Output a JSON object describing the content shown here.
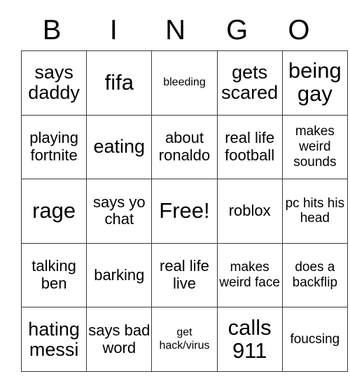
{
  "card": {
    "title": "BINGO",
    "headers": [
      "B",
      "I",
      "N",
      "G",
      "O"
    ],
    "free_space_label": "Free!",
    "border_color": "#3a3a3a",
    "text_color": "#000000",
    "background_color": "#ffffff",
    "rows": [
      [
        {
          "text": "says daddy",
          "size": "lg"
        },
        {
          "text": "fifa",
          "size": "xl"
        },
        {
          "text": "bleeding",
          "size": "xs"
        },
        {
          "text": "gets scared",
          "size": "lg"
        },
        {
          "text": "being gay",
          "size": "xl"
        }
      ],
      [
        {
          "text": "playing fortnite",
          "size": "md"
        },
        {
          "text": "eating",
          "size": "lg"
        },
        {
          "text": "about ronaldo",
          "size": "md"
        },
        {
          "text": "real life football",
          "size": "md"
        },
        {
          "text": "makes weird sounds",
          "size": "sm"
        }
      ],
      [
        {
          "text": "rage",
          "size": "xl"
        },
        {
          "text": "says yo chat",
          "size": "md"
        },
        {
          "text": "Free!",
          "size": "xl"
        },
        {
          "text": "roblox",
          "size": "md"
        },
        {
          "text": "pc hits his head",
          "size": "sm"
        }
      ],
      [
        {
          "text": "talking ben",
          "size": "md"
        },
        {
          "text": "barking",
          "size": "md"
        },
        {
          "text": "real life live",
          "size": "md"
        },
        {
          "text": "makes weird face",
          "size": "sm"
        },
        {
          "text": "does a backflip",
          "size": "sm"
        }
      ],
      [
        {
          "text": "hating messi",
          "size": "lg"
        },
        {
          "text": "says bad word",
          "size": "md"
        },
        {
          "text": "get hack/virus",
          "size": "xs"
        },
        {
          "text": "calls 911",
          "size": "xl"
        },
        {
          "text": "foucsing",
          "size": "sm"
        }
      ]
    ]
  }
}
